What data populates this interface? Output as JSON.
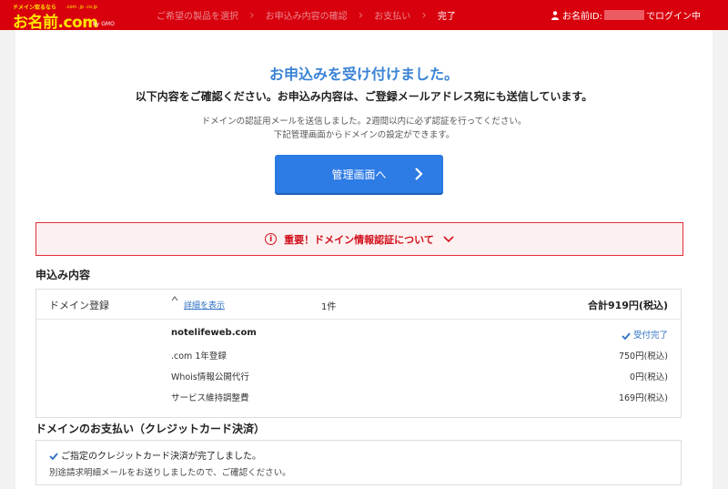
{
  "header": {
    "logo_tagline": "ドメイン取るなら",
    "logo_text": "お名前.com",
    "logo_small": ".com .jp .co.jp",
    "logo_sub": "by GMO",
    "steps": [
      "ご希望の製品を選択",
      "お申込み内容の確認",
      "お支払い",
      "完了"
    ],
    "user_prefix": "お名前ID:",
    "user_suffix": "でログイン中"
  },
  "main": {
    "title": "お申込みを受け付けました。",
    "subtitle": "以下内容をご確認ください。お申込み内容は、ご登録メールアドレス宛にも送信しています。",
    "notice_line1": "ドメインの認証用メールを送信しました。2週間以内に必ず認証を行ってください。",
    "notice_line2": "下記管理画面からドメインの設定ができます。",
    "admin_button": "管理画面へ",
    "alert_text": "重要！ドメイン情報認証について"
  },
  "order": {
    "section_title": "申込み内容",
    "label": "ドメイン登録",
    "detail_link": "詳細を表示",
    "count": "1件",
    "total": "合計919円(税込)",
    "rows": [
      {
        "left": "notelifeweb.com",
        "right": "受付完了"
      },
      {
        "left": ".com 1年登録",
        "right": "750円(税込)"
      },
      {
        "left": "Whois情報公開代行",
        "right": "0円(税込)"
      },
      {
        "left": "サービス維持調整費",
        "right": "169円(税込)"
      }
    ]
  },
  "payment": {
    "section_title": "ドメインのお支払い（クレジットカード決済）",
    "line1": "ご指定のクレジットカード決済が完了しました。",
    "line2": "別途請求明細メールをお送りしましたので、ご確認ください。"
  },
  "colors": {
    "brand_red": "#d9000d",
    "accent_blue": "#2d7be5",
    "alert_red": "#d10f1b"
  }
}
